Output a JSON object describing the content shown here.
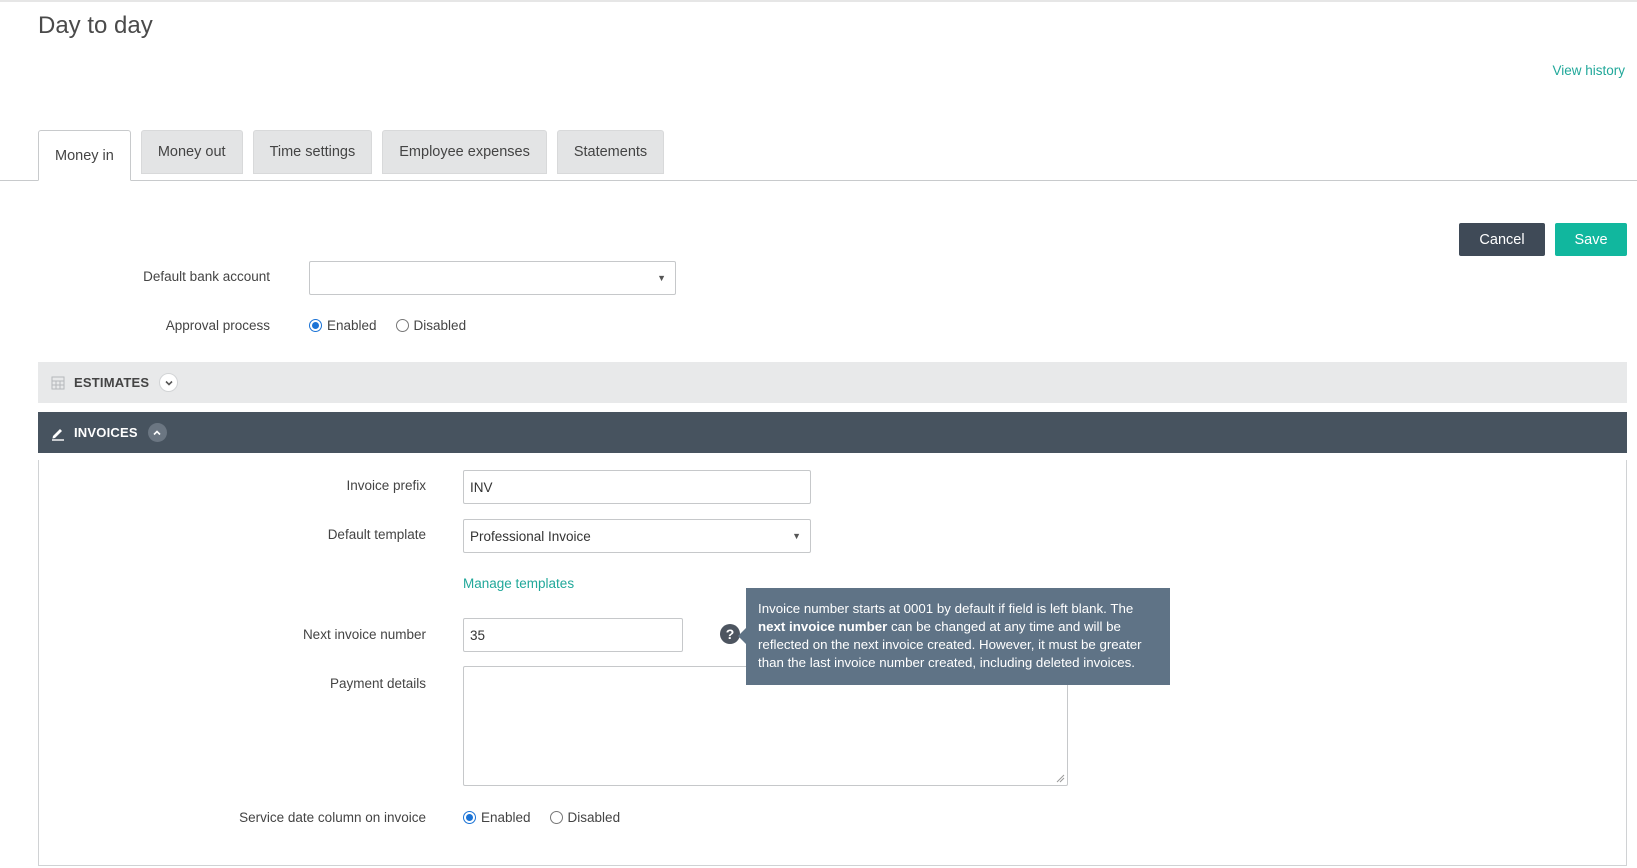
{
  "page": {
    "title": "Day to day",
    "view_history": "View history"
  },
  "tabs": [
    {
      "label": "Money in",
      "active": true
    },
    {
      "label": "Money out",
      "active": false
    },
    {
      "label": "Time settings",
      "active": false
    },
    {
      "label": "Employee expenses",
      "active": false
    },
    {
      "label": "Statements",
      "active": false
    }
  ],
  "actions": {
    "cancel_label": "Cancel",
    "save_label": "Save"
  },
  "general": {
    "default_bank_account_label": "Default bank account",
    "default_bank_account_value": "",
    "approval_process_label": "Approval process",
    "approval_enabled_label": "Enabled",
    "approval_disabled_label": "Disabled",
    "approval_selected": "Enabled"
  },
  "sections": {
    "estimates_title": "ESTIMATES",
    "invoices_title": "INVOICES"
  },
  "invoices": {
    "prefix_label": "Invoice prefix",
    "prefix_value": "INV",
    "template_label": "Default template",
    "template_value": "Professional Invoice",
    "manage_templates": "Manage templates",
    "next_number_label": "Next invoice number",
    "next_number_value": "35",
    "payment_details_label": "Payment details",
    "payment_details_value": "",
    "service_date_label": "Service date column on invoice",
    "service_enabled_label": "Enabled",
    "service_disabled_label": "Disabled",
    "service_selected": "Enabled"
  },
  "tooltip": {
    "part1": "Invoice number starts at 0001 by default if field is left blank. The ",
    "bold": "next invoice number",
    "part2": " can be changed at any time and will be reflected on the next invoice created. However, it must be greater than the last invoice number created, including deleted invoices."
  },
  "colors": {
    "accent_teal": "#11b79e",
    "link_teal": "#21a89a",
    "dark_slate": "#47535f",
    "tooltip_bg": "#5f7386",
    "radio_blue": "#1b73d6"
  },
  "icons": {
    "estimates": "calculator-icon",
    "invoices": "pencil-edit-icon",
    "estimates_toggle": "chevron-down-icon",
    "invoices_toggle": "chevron-up-icon",
    "help": "question-mark-icon",
    "dropdown": "caret-down-icon"
  }
}
